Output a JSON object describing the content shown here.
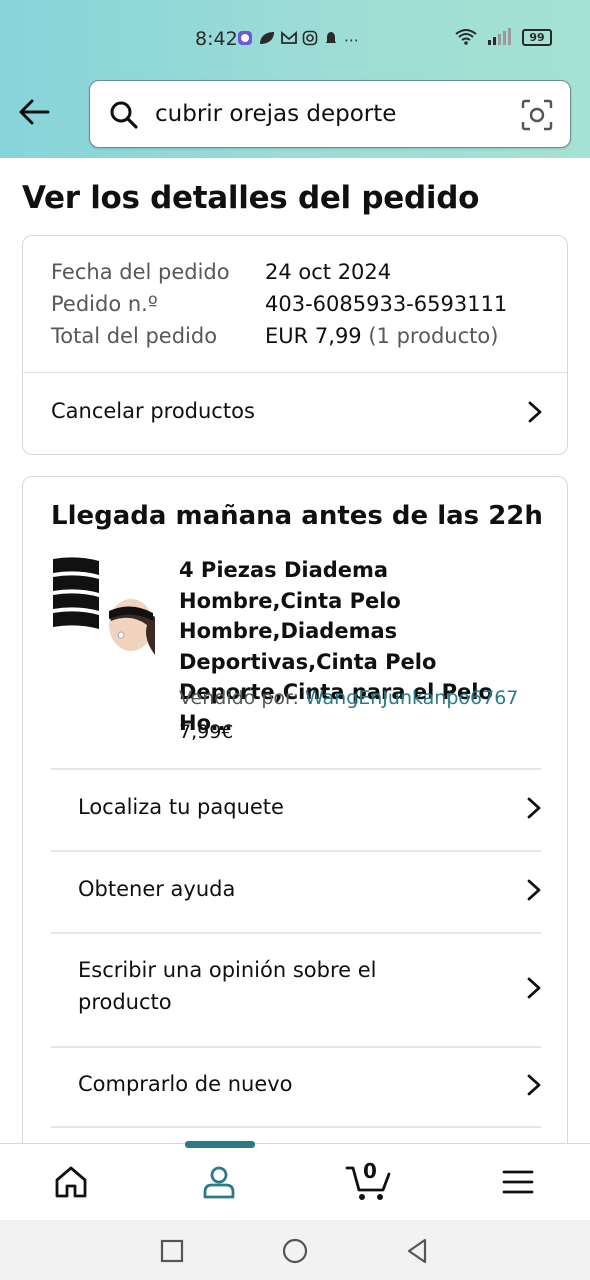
{
  "status_bar": {
    "time": "8:42",
    "icons": [
      "messenger-icon",
      "leaf-icon",
      "mail-icon",
      "instagram-icon",
      "notification-icon",
      "more-icon"
    ],
    "battery": "99"
  },
  "search": {
    "value": "cubrir orejas deporte"
  },
  "page": {
    "title": "Ver los detalles del pedido"
  },
  "order": {
    "date_label": "Fecha del pedido",
    "date_value": "24 oct 2024",
    "number_label": "Pedido n.º",
    "number_value": "403-6085933-6593111",
    "total_label": "Total del pedido",
    "total_value": "EUR 7,99",
    "total_count": "(1 producto)",
    "cancel_label": "Cancelar productos"
  },
  "delivery": {
    "title": "Llegada mañana antes de las 22h",
    "product_title": "4 Piezas Diadema Hombre,Cinta Pelo Hombre,Diademas Deportivas,Cinta Pelo Deporte,Cinta para el Pelo Ho…",
    "sold_by_label": "Vendido por:",
    "seller": "WangEnJunkanpo6767",
    "price": "7,99€",
    "actions": [
      {
        "label": "Localiza tu paquete"
      },
      {
        "label": "Obtener ayuda"
      },
      {
        "label": "Escribir una opinión sobre el producto"
      },
      {
        "label": "Comprarlo de nuevo"
      }
    ]
  },
  "bottom_nav": {
    "items": [
      "home-icon",
      "account-icon",
      "cart-icon",
      "menu-icon"
    ],
    "cart_count": "0",
    "active": "account-icon"
  },
  "colors": {
    "accent": "#2a7a8a",
    "header_gradient_start": "#86d4da",
    "header_gradient_end": "#a6e2d3"
  }
}
